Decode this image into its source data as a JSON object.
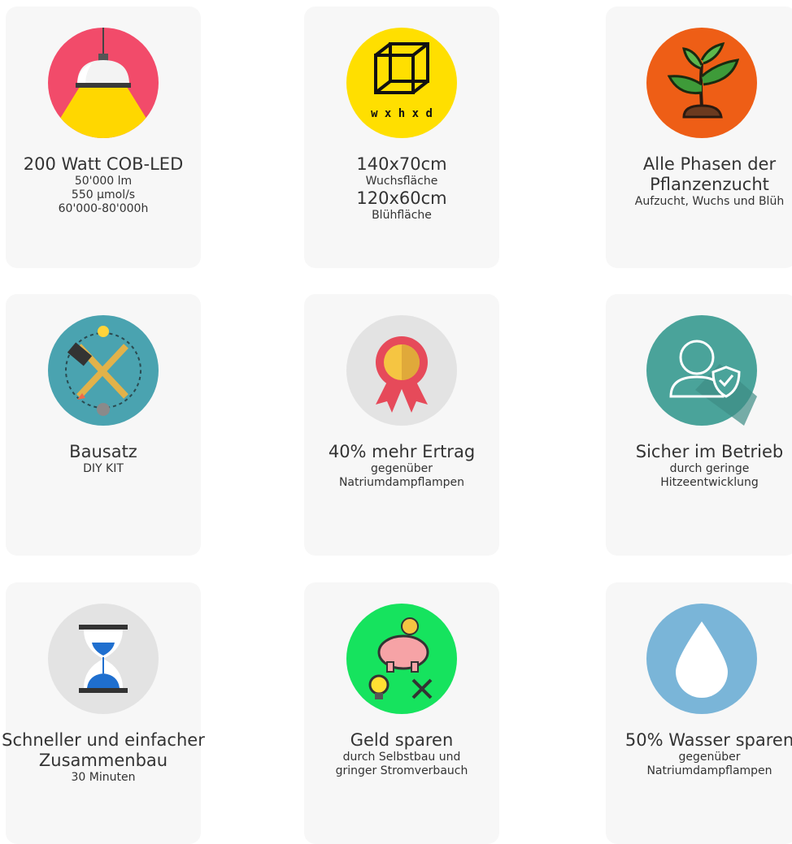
{
  "cards": [
    {
      "title": "200 Watt COB-LED",
      "lines": [
        "50'000 lm",
        "550 µmol/s",
        "60'000-80'000h"
      ]
    },
    {
      "title": "140x70cm",
      "sub": "Wuchsfläche",
      "title2": "120x60cm",
      "sub2": "Blühfläche",
      "icon_text": "w x h x d"
    },
    {
      "title_lines": [
        "Alle Phasen der",
        "Pflanzenzucht"
      ],
      "sub": "Aufzucht, Wuchs und Blüh"
    },
    {
      "title": "Bausatz",
      "sub": "DIY KIT"
    },
    {
      "title": "40% mehr Ertrag",
      "lines": [
        "gegenüber",
        "Natriumdampflampen"
      ]
    },
    {
      "title": "Sicher im Betrieb",
      "lines": [
        "durch geringe",
        "Hitzeentwicklung"
      ]
    },
    {
      "title_lines": [
        "Schneller und einfacher",
        "Zusammenbau"
      ],
      "sub": "30 Minuten"
    },
    {
      "title": "Geld sparen",
      "lines": [
        "durch Selbstbau und",
        "gringer Stromverbauch"
      ]
    },
    {
      "title": "50% Wasser sparen",
      "lines": [
        "gegenüber",
        "Natriumdampflampen"
      ]
    }
  ],
  "colors": {
    "pink": "#f24b6a",
    "yellow": "#ffdf00",
    "orange": "#ee5e16",
    "teal": "#4aa3b0",
    "grey": "#e3e3e3",
    "green": "#16e35e",
    "blue_drop": "#7ab5d8",
    "shield_teal": "#3d9a8f"
  }
}
